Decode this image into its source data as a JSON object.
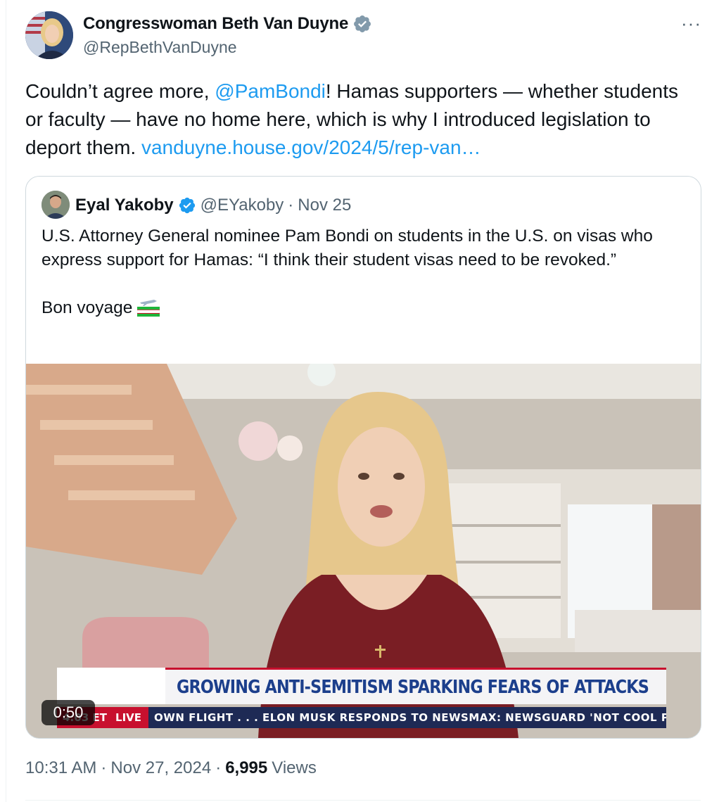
{
  "author": {
    "display_name": "Congresswoman Beth Van Duyne",
    "handle": "@RepBethVanDuyne",
    "verified_badge": "verified-badge-icon",
    "avatar": "avatar"
  },
  "more_icon": "···",
  "tweet": {
    "text_1": "Couldn’t agree more, ",
    "mention": "@PamBondi",
    "text_2": "! Hamas supporters — whether students or faculty — have no home here, which is why I introduced legislation to deport them. ",
    "link": "vanduyne.house.gov/2024/5/rep-van…"
  },
  "quote": {
    "display_name": "Eyal Yakoby",
    "handle": "@EYakoby",
    "separator": "·",
    "date": "Nov 25",
    "line_1": "U.S. Attorney General nominee Pam Bondi on students in the U.S. on visas who express support for Hamas: “I think their student visas need to be revoked.”",
    "line_2": "Bon voyage",
    "emoji": "airplane-flag-emoji",
    "video": {
      "duration": "0:50",
      "chyron": "GROWING ANTI-SEMITISM SPARKING FEARS OF ATTACKS",
      "ticker_time": "4:03 ET",
      "ticker_live": "LIVE",
      "ticker_text": "OWN FLIGHT . . .     ELON MUSK RESPONDS TO NEWSMAX: NEWSGUARD 'NOT COOL PU"
    }
  },
  "footer": {
    "time": "10:31 AM",
    "sep1": "·",
    "date": "Nov 27, 2024",
    "sep2": "·",
    "views_count": "6,995",
    "views_label": "Views"
  },
  "colors": {
    "link": "#1d9bf0",
    "verified": "#1d9bf0",
    "muted": "#536471",
    "border": "#cfd9de"
  }
}
